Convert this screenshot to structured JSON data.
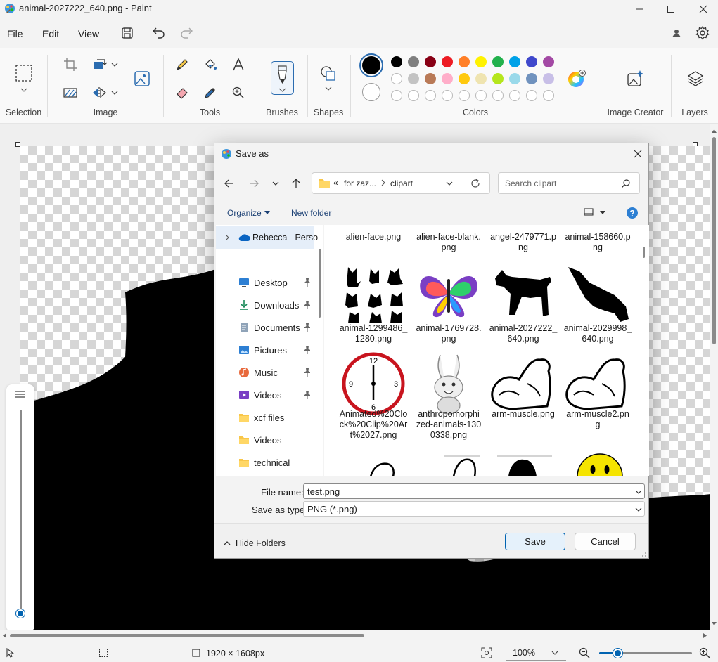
{
  "window": {
    "title": "animal-2027222_640.png - Paint"
  },
  "menu": {
    "file": "File",
    "edit": "Edit",
    "view": "View"
  },
  "ribbon": {
    "groups": {
      "selection": "Selection",
      "image": "Image",
      "tools": "Tools",
      "brushes": "Brushes",
      "shapes": "Shapes",
      "colors": "Colors",
      "image_creator": "Image Creator",
      "layers": "Layers"
    },
    "palette_row1": [
      "#000000",
      "#7f7f7f",
      "#880015",
      "#ed1c24",
      "#ff7f27",
      "#fff200",
      "#22b14c",
      "#00a2e8",
      "#3f48cc",
      "#a349a4"
    ],
    "palette_row2": [
      "#ffffff",
      "#c3c3c3",
      "#b97a57",
      "#ffaec9",
      "#ffc90e",
      "#efe4b0",
      "#b5e61d",
      "#99d9ea",
      "#7092be",
      "#c8bfe7"
    ],
    "primary_color": "#000000",
    "secondary_color": "#ffffff"
  },
  "status": {
    "dimensions": "1920 × 1608px",
    "zoom": "100%",
    "zoom_level": 0.2
  },
  "dialog": {
    "title": "Save as",
    "address": {
      "prefix": "«",
      "segment1": "for zaz...",
      "segment2": "clipart"
    },
    "search_placeholder": "Search clipart",
    "organize": "Organize",
    "new_folder": "New folder",
    "nav": {
      "onedrive": "Rebecca - Perso",
      "items": [
        {
          "label": "Desktop",
          "icon": "desktop-icon",
          "pinned": true
        },
        {
          "label": "Downloads",
          "icon": "downloads-icon",
          "pinned": true
        },
        {
          "label": "Documents",
          "icon": "documents-icon",
          "pinned": true
        },
        {
          "label": "Pictures",
          "icon": "pictures-icon",
          "pinned": true
        },
        {
          "label": "Music",
          "icon": "music-icon",
          "pinned": true
        },
        {
          "label": "Videos",
          "icon": "videos-icon",
          "pinned": true
        },
        {
          "label": "xcf files",
          "icon": "folder-icon",
          "pinned": false
        },
        {
          "label": "Videos",
          "icon": "folder-icon",
          "pinned": false
        },
        {
          "label": "technical",
          "icon": "folder-icon",
          "pinned": false
        }
      ]
    },
    "files": [
      {
        "name": "alien-face.png"
      },
      {
        "name": "alien-face-blank.\npng"
      },
      {
        "name": "angel-2479771.p\nng"
      },
      {
        "name": "animal-158660.p\nng"
      },
      {
        "name": "animal-1299486_\n1280.png"
      },
      {
        "name": "animal-1769728.\npng"
      },
      {
        "name": "animal-2027222_\n640.png"
      },
      {
        "name": "animal-2029998_\n640.png"
      },
      {
        "name": "Animated%20Clo\nck%20Clip%20Ar\nt%2027.png"
      },
      {
        "name": "anthropomorphi\nzed-animals-130\n0338.png"
      },
      {
        "name": "arm-muscle.png"
      },
      {
        "name": "arm-muscle2.pn\ng"
      }
    ],
    "file_name_label": "File name:",
    "file_name_value": "test.png",
    "save_type_label": "Save as type:",
    "save_type_value": "PNG (*.png)",
    "hide_folders": "Hide Folders",
    "save": "Save",
    "cancel": "Cancel"
  }
}
